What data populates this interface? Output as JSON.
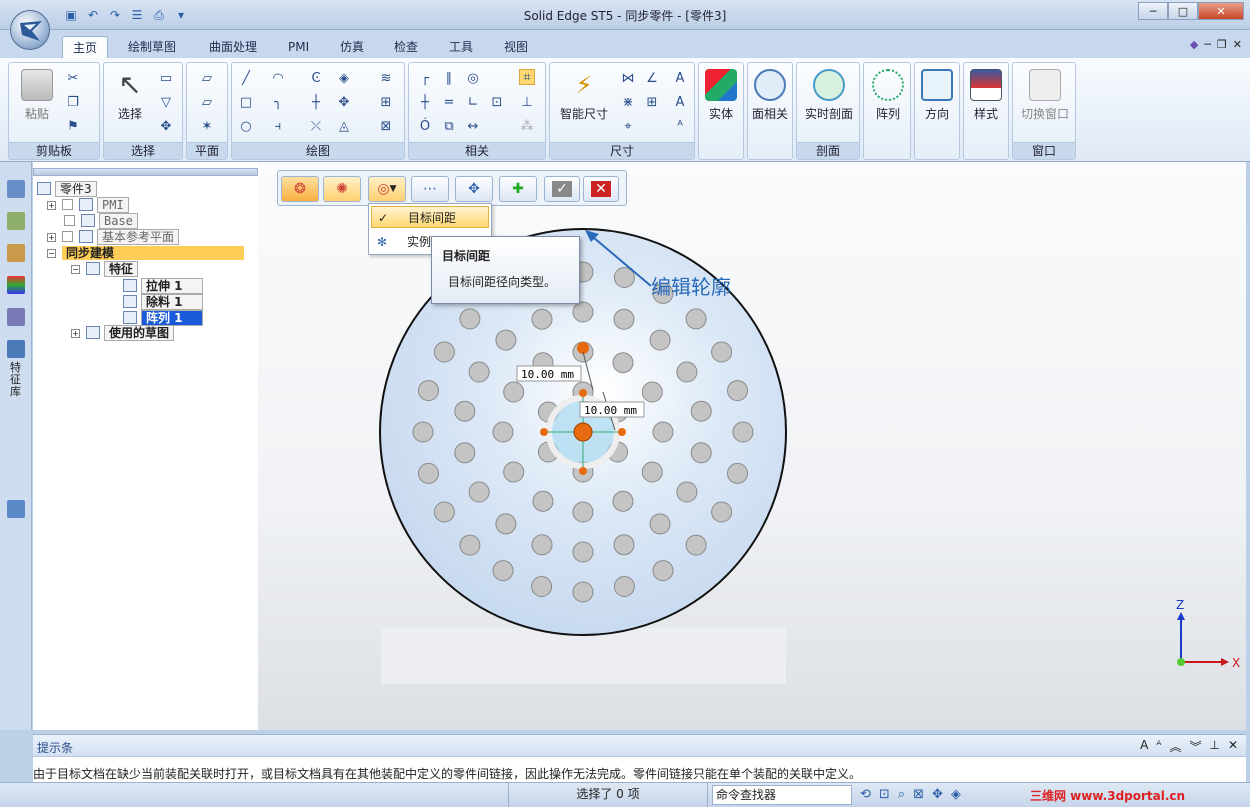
{
  "window": {
    "title": "Solid Edge ST5 - 同步零件 - [零件3]"
  },
  "tabs": [
    "主页",
    "绘制草图",
    "曲面处理",
    "PMI",
    "仿真",
    "检查",
    "工具",
    "视图"
  ],
  "ribbon": {
    "clipboard": {
      "label": "剪贴板",
      "paste": "粘贴"
    },
    "select": {
      "label": "选择",
      "select": "选择"
    },
    "plane": {
      "label": "平面"
    },
    "draw": {
      "label": "绘图"
    },
    "relate": {
      "label": "相关"
    },
    "dimension": {
      "label": "尺寸",
      "smart": "智能尺寸"
    },
    "solid": {
      "label": "实体"
    },
    "face": {
      "label": "面相关"
    },
    "section": {
      "label": "剖面",
      "live": "实时剖面"
    },
    "pattern": {
      "label": "阵列"
    },
    "orient": {
      "label": "方向"
    },
    "style": {
      "label": "样式"
    },
    "window": {
      "label": "窗口",
      "switch": "切换窗口"
    }
  },
  "tree": {
    "root": "零件3",
    "pmi": "PMI",
    "base": "Base",
    "refplanes": "基本参考平面",
    "sync": "同步建模",
    "features": "特征",
    "f1": "拉伸 1",
    "f2": "除料 1",
    "f3": "阵列 1",
    "sketches": "使用的草图",
    "side_tab": "特征库"
  },
  "dropdown": {
    "item1": "目标间距",
    "item2": "实例"
  },
  "tooltip": {
    "title": "目标间距",
    "body": "目标间距径向类型。"
  },
  "canvas": {
    "edit_profile": "编辑轮廓",
    "dim1": "10.00 mm",
    "dim2": "10.00 mm",
    "axis_z": "Z",
    "axis_x": "X"
  },
  "prompt": {
    "title": "提示条",
    "message": "由于目标文档在缺少当前装配关联时打开，或目标文档具有在其他装配中定义的零件间链接，因此操作无法完成。零件间链接只能在单个装配的关联中定义。"
  },
  "status": {
    "selected": "选择了 0 项",
    "finder": "命令查找器",
    "watermark": "三维网 www.3dportal.cn"
  },
  "colors": {
    "accent": "#2a5ea8",
    "highlight": "#ffd873",
    "disk": "#dbe8f6"
  }
}
